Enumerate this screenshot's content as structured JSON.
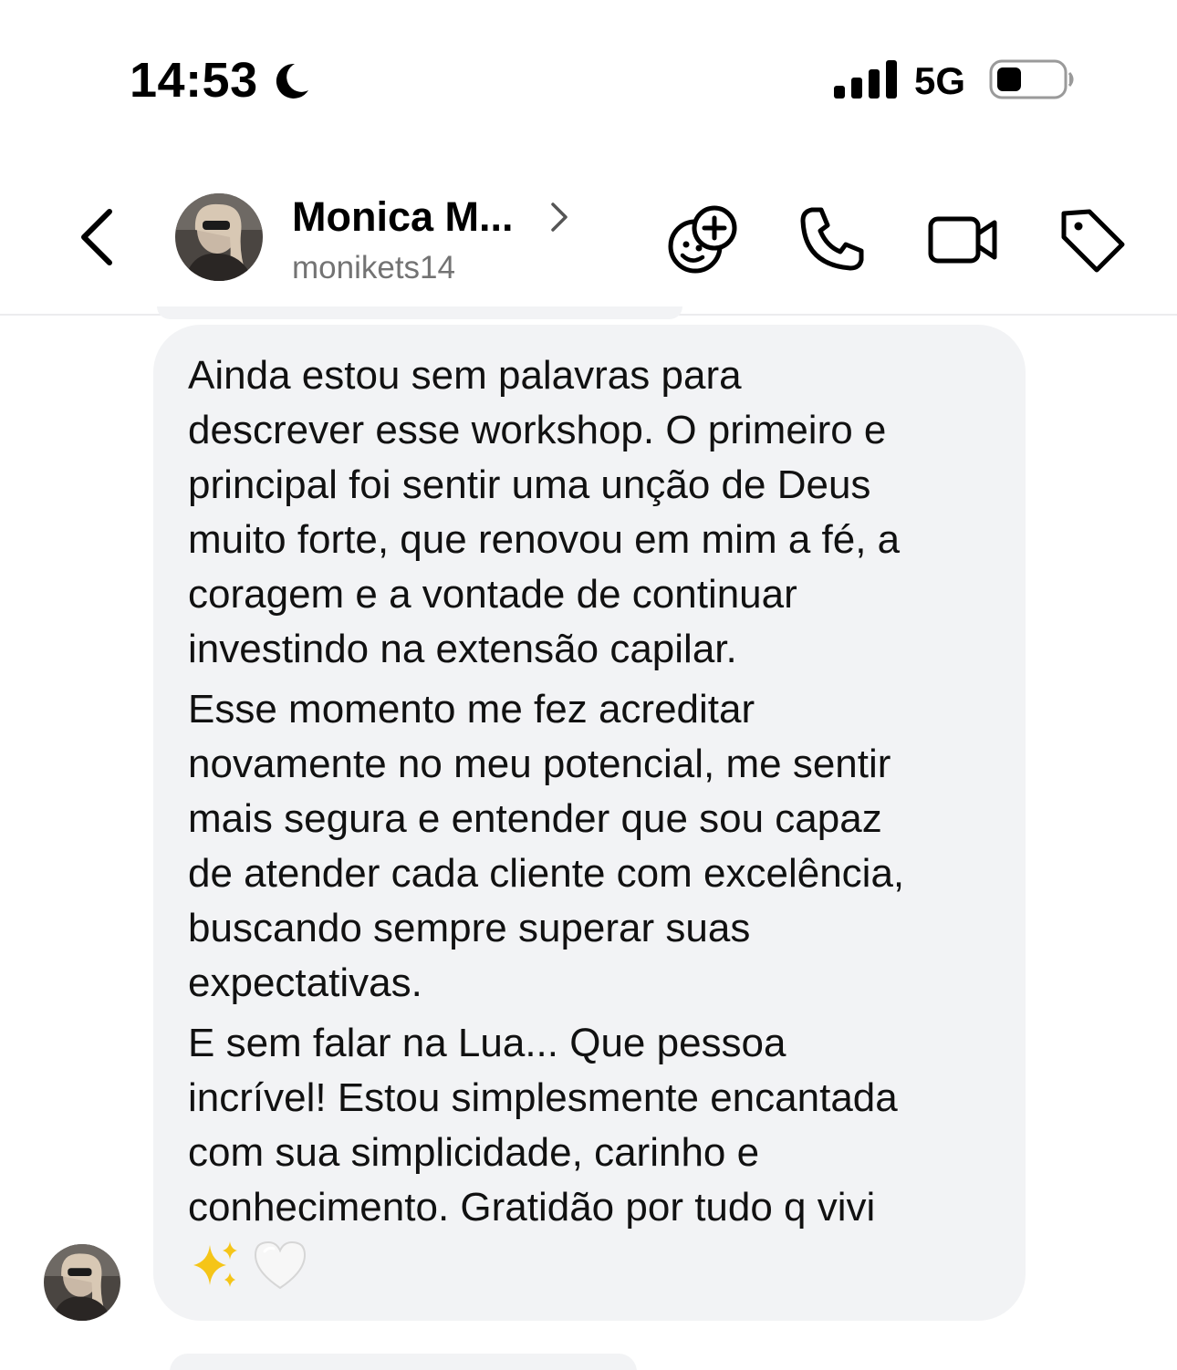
{
  "status_bar": {
    "time": "14:53",
    "network": "5G",
    "icons": [
      "moon-icon",
      "signal-icon",
      "battery-icon"
    ]
  },
  "header": {
    "contact_name": "Monica M...",
    "username": "monikets14",
    "icons": [
      "back-icon",
      "avatar",
      "chevron-right-icon",
      "sticker-add-icon",
      "phone-icon",
      "video-camera-icon",
      "tag-icon"
    ]
  },
  "message": {
    "paragraphs": [
      "Ainda estou sem palavras para\ndescrever esse workshop. O primeiro e\nprincipal foi sentir uma unção de Deus\nmuito forte, que renovou em mim a fé, a\ncoragem e a vontade de continuar\ninvestindo na extensão capilar.",
      "Esse momento me fez acreditar\nnovamente no meu potencial, me sentir\nmais segura e entender que sou capaz\nde atender cada cliente com excelência,\nbuscando sempre superar suas\nexpectativas.",
      "E sem falar na Lua... Que pessoa\nincrível! Estou simplesmente encantada\ncom sua simplicidade, carinho e\nconhecimento. Gratidão por tudo q vivi"
    ],
    "emojis": [
      "sparkles-icon",
      "white-heart-icon"
    ]
  },
  "colors": {
    "bubble_background": "#f2f3f5",
    "text": "#111111",
    "secondary_text": "#737373",
    "sparkles": "#f5c518"
  }
}
